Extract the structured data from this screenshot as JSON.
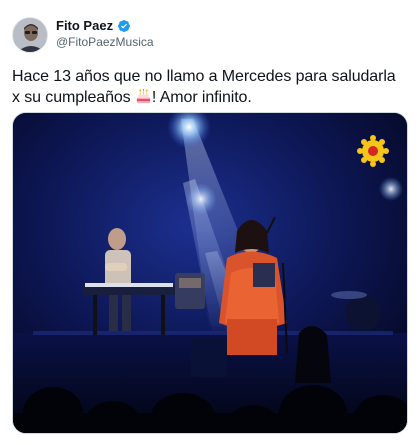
{
  "author": {
    "display_name": "Fito Paez",
    "handle": "@FitoPaezMusica",
    "avatar_icon": "avatar-photo",
    "verified_icon": "verified-badge-icon",
    "verified_color": "#1d9bf0"
  },
  "tweet": {
    "text_line1": "Hace 13 años que no llamo a Mercedes para saludarla",
    "text_line2_before_emoji": "x su cumpleaños ",
    "emoji_icon": "birthday-cake-icon",
    "text_line2_after_emoji": "! Amor infinito."
  },
  "media": {
    "type": "video-frame",
    "scene_icon": "concert-stage-image",
    "channel_logo_icon": "tv-channel-logo-icon"
  },
  "colors": {
    "text": "#0f1419",
    "secondary_text": "#536471",
    "border": "#cfd9de",
    "stage_blue": "#1a3aa8"
  }
}
